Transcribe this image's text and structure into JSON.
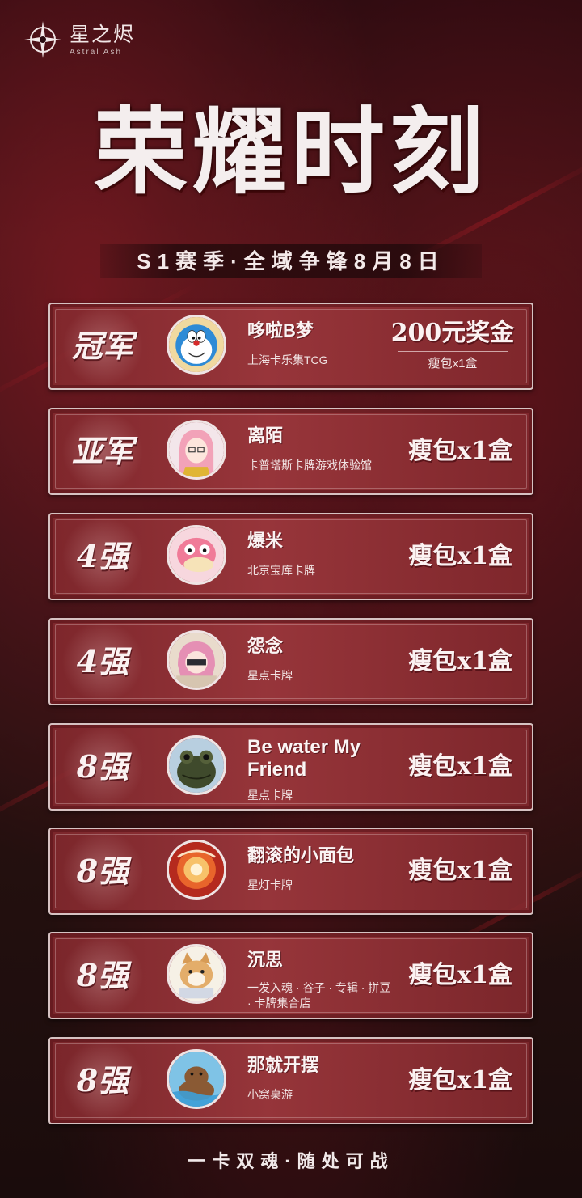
{
  "brand": {
    "name_cn": "星之烬",
    "name_en": "Astral Ash"
  },
  "title": "荣耀时刻",
  "subtitle": "S1赛季·全域争锋8月8日",
  "rankings": [
    {
      "rank": "冠军",
      "name": "哆啦B梦",
      "store": "上海卡乐集TCG",
      "prize": "200元奖金",
      "prize_sub": "瘦包x1盒",
      "avatar": "doraemon-avatar"
    },
    {
      "rank": "亚军",
      "name": "离陌",
      "store": "卡普塔斯卡牌游戏体验馆",
      "prize": "瘦包x1盒",
      "avatar": "anime-girl-avatar"
    },
    {
      "rank": "4强",
      "name": "爆米",
      "store": "北京宝库卡牌",
      "prize": "瘦包x1盒",
      "avatar": "slowpoke-avatar"
    },
    {
      "rank": "4强",
      "name": "怨念",
      "store": "星点卡牌",
      "prize": "瘦包x1盒",
      "avatar": "pink-hair-avatar"
    },
    {
      "rank": "8强",
      "name": "Be water My Friend",
      "store": "星点卡牌",
      "prize": "瘦包x1盒",
      "avatar": "frog-avatar"
    },
    {
      "rank": "8强",
      "name": "翻滚的小面包",
      "store": "星灯卡牌",
      "prize": "瘦包x1盒",
      "avatar": "bread-avatar"
    },
    {
      "rank": "8强",
      "name": "沉思",
      "store": "一发入魂 · 谷子 · 专辑 · 拼豆 · 卡牌集合店",
      "prize": "瘦包x1盒",
      "avatar": "cat-avatar"
    },
    {
      "rank": "8强",
      "name": "那就开摆",
      "store": "小窝桌游",
      "prize": "瘦包x1盒",
      "avatar": "capybara-avatar"
    }
  ],
  "footer": "一卡双魂·随处可战"
}
